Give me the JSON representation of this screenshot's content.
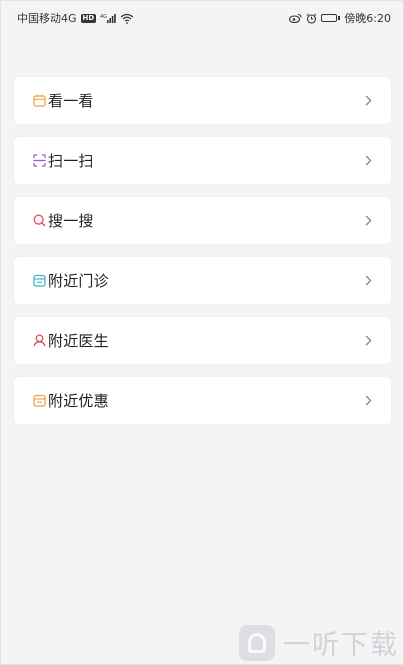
{
  "status_bar": {
    "carrier": "中国移动4G",
    "hd_badge": "HD",
    "network_label": "4G",
    "time": "傍晚6:20",
    "battery_level": 0.6,
    "icons": [
      "hd-badge-icon",
      "signal-icon",
      "wifi-icon",
      "weibo-icon",
      "alarm-icon",
      "battery-icon"
    ]
  },
  "menu": {
    "items": [
      {
        "label": "看一看",
        "icon": "calendar-icon",
        "color": "#f0a04b"
      },
      {
        "label": "扫一扫",
        "icon": "scan-icon",
        "color": "#9b59d6"
      },
      {
        "label": "搜一搜",
        "icon": "search-icon",
        "color": "#ef4d6b"
      },
      {
        "label": "附近门诊",
        "icon": "clinic-icon",
        "color": "#3fb8c4"
      },
      {
        "label": "附近医生",
        "icon": "doctor-icon",
        "color": "#e8455a"
      },
      {
        "label": "附近优惠",
        "icon": "coupon-icon",
        "color": "#f0a04b"
      }
    ],
    "chevron_icon": "chevron-right-icon",
    "chevron_color": "#888888"
  },
  "watermark": {
    "text": "一听下载",
    "logo_icon": "ear-logo-icon"
  }
}
